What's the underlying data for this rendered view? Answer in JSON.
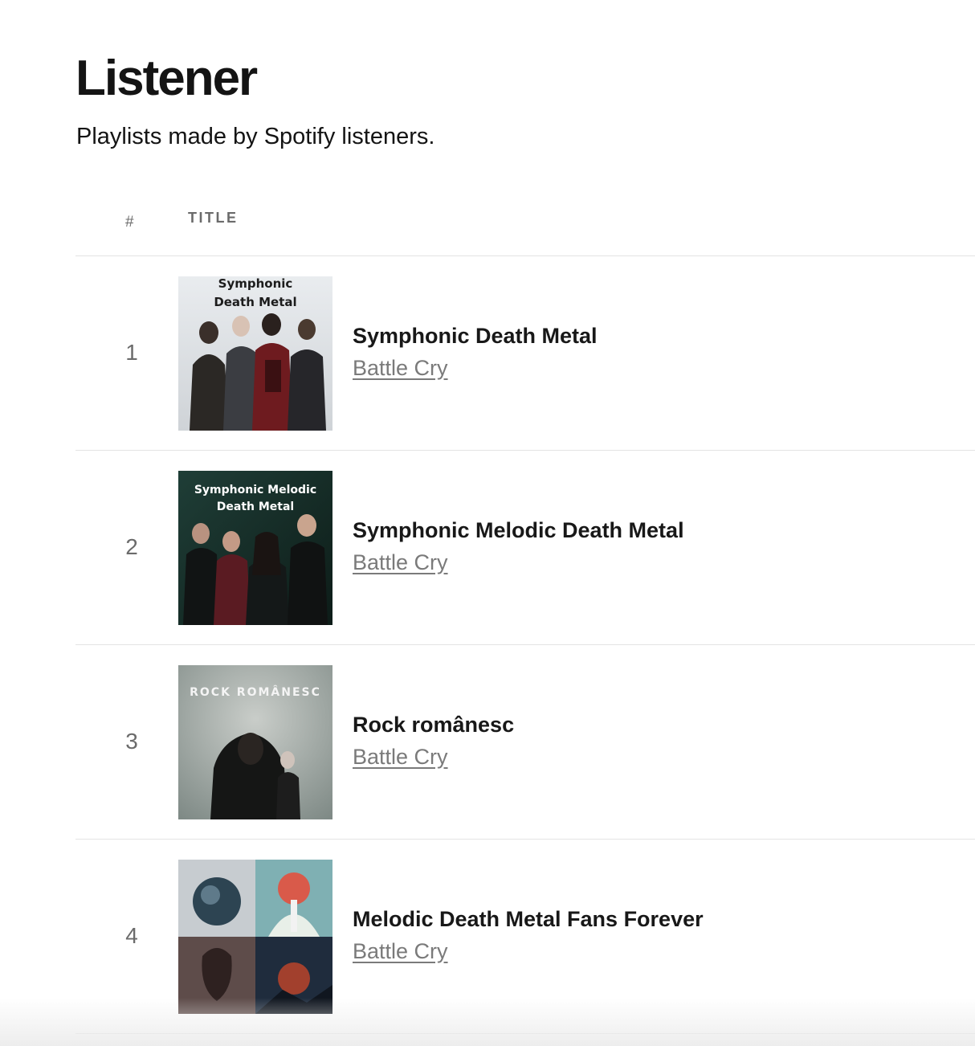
{
  "header": {
    "title": "Listener",
    "subtitle": "Playlists made by Spotify listeners."
  },
  "table": {
    "col_number": "#",
    "col_title": "TITLE"
  },
  "playlists": [
    {
      "number": "1",
      "title": "Symphonic Death Metal",
      "author": "Battle Cry",
      "cover_text_line1": "Symphonic",
      "cover_text_line2": "Death Metal"
    },
    {
      "number": "2",
      "title": "Symphonic Melodic Death Metal",
      "author": "Battle Cry",
      "cover_text_line1": "Symphonic Melodic",
      "cover_text_line2": "Death Metal"
    },
    {
      "number": "3",
      "title": "Rock românesc",
      "author": "Battle Cry",
      "cover_text_line1": "ROCK ROMÂNESC"
    },
    {
      "number": "4",
      "title": "Melodic Death Metal Fans Forever",
      "author": "Battle Cry"
    }
  ]
}
